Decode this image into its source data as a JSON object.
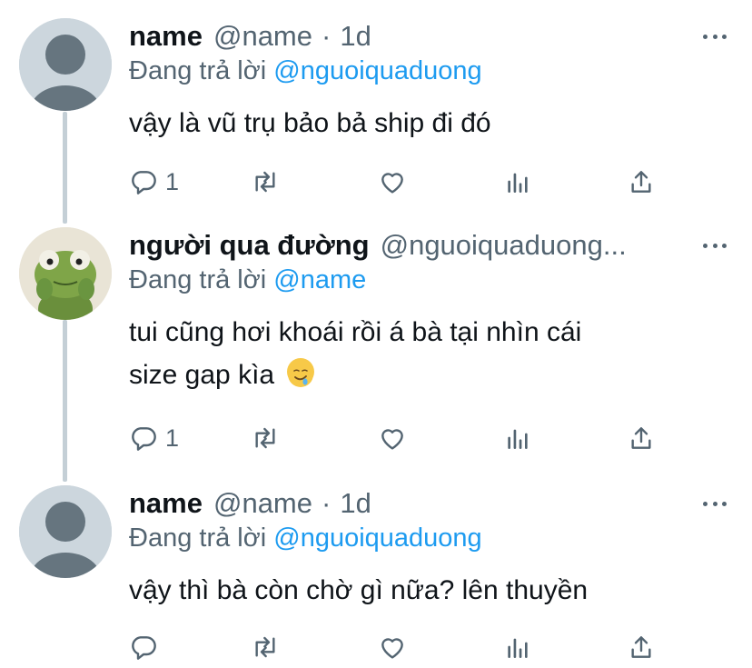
{
  "tweets": [
    {
      "display_name": "name",
      "handle": "@name",
      "separator": "·",
      "time": "1d",
      "replying_prefix": "Đang trả lời",
      "replying_to": "@nguoiquaduong",
      "text": "vậy là vũ trụ bảo bả ship đi đó",
      "reply_count": "1",
      "avatar": "default-avatar"
    },
    {
      "display_name": "người qua đường",
      "handle": "@nguoiquaduong...",
      "replying_prefix": "Đang trả lời",
      "replying_to": "@name",
      "text_line1": "tui cũng hơi khoái rồi á bà tại nhìn cái",
      "text_line2": "size gap kìa",
      "emoji": "drooling-face",
      "reply_count": "1",
      "avatar": "kermit-frog-avatar"
    },
    {
      "display_name": "name",
      "handle": "@name",
      "separator": "·",
      "time": "1d",
      "replying_prefix": "Đang trả lời",
      "replying_to": "@nguoiquaduong",
      "text": "vậy thì bà còn chờ gì nữa? lên thuyền",
      "reply_count": "",
      "avatar": "default-avatar"
    }
  ],
  "icons": [
    "reply-icon",
    "retweet-icon",
    "like-icon",
    "analytics-icon",
    "share-icon",
    "more-icon"
  ],
  "colors": {
    "link": "#1d9bf0",
    "secondary_text": "#536471",
    "primary_text": "#0f1419",
    "thread_line": "#c4cfd6",
    "default_avatar_bg": "#ccd6dd",
    "default_avatar_fg": "#66757f"
  }
}
